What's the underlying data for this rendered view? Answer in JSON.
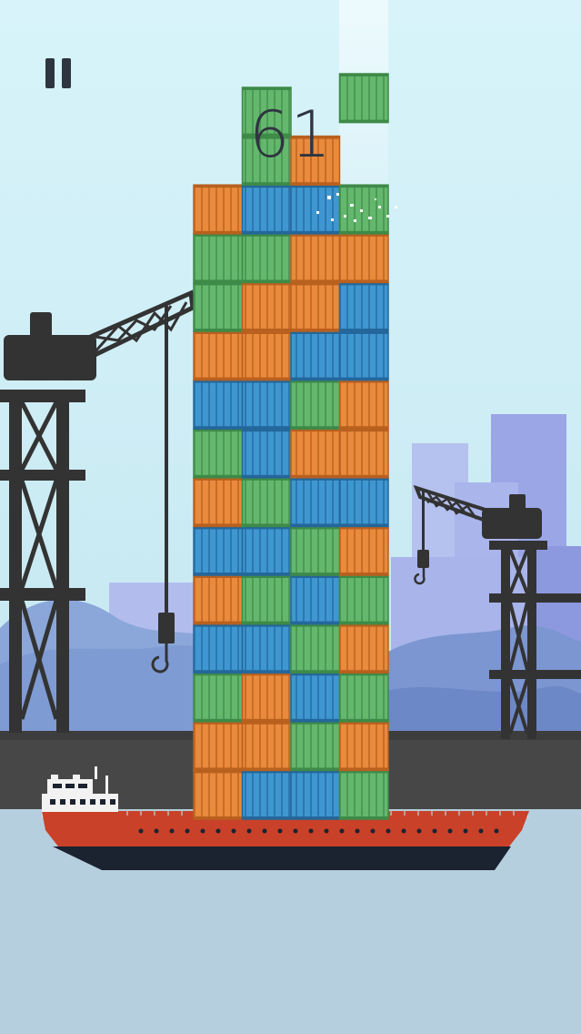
{
  "hud": {
    "score": "61",
    "pause_icon": "pause-icon"
  },
  "colors": {
    "sky_top": "#d8f4fa",
    "sky_bottom": "#c4e6f0",
    "water": "#b6cfde",
    "dock": "#474747",
    "crane": "#333333",
    "ship_hull": "#c94128",
    "ship_keel": "#1b2230",
    "container_orange": "#e98a3c",
    "container_green": "#64b86d",
    "container_blue": "#3f97d1",
    "city_light": "#b9c6ee",
    "city_dark": "#8e9be3",
    "hills": "#7f9bd3"
  },
  "tower": {
    "columns": 4,
    "rows_bottom_to_top": [
      [
        "orange",
        "blue",
        "blue",
        "green"
      ],
      [
        "orange",
        "orange",
        "green",
        "orange"
      ],
      [
        "green",
        "orange",
        "blue",
        "green"
      ],
      [
        "blue",
        "blue",
        "green",
        "orange"
      ],
      [
        "orange",
        "green",
        "blue",
        "green"
      ],
      [
        "blue",
        "blue",
        "green",
        "orange"
      ],
      [
        "orange",
        "green",
        "blue",
        "blue"
      ],
      [
        "green",
        "blue",
        "orange",
        "orange"
      ],
      [
        "blue",
        "blue",
        "green",
        "orange"
      ],
      [
        "orange",
        "orange",
        "blue",
        "blue"
      ],
      [
        "green",
        "orange",
        "orange",
        "blue"
      ],
      [
        "green",
        "green",
        "orange",
        "orange"
      ],
      [
        "orange",
        "blue",
        "blue",
        "green"
      ],
      [
        "",
        "green",
        "orange",
        ""
      ],
      [
        "",
        "green",
        "",
        ""
      ]
    ],
    "dropping_container": "green"
  }
}
